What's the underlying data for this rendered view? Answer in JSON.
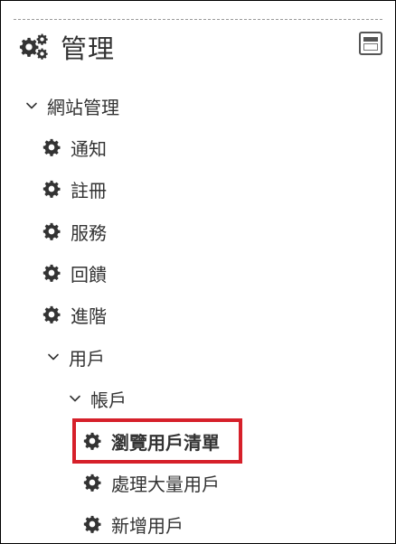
{
  "block": {
    "title": "管理",
    "icon": "gears-icon",
    "collapse_icon": "collapse-block-icon"
  },
  "tree": {
    "site_admin": {
      "label": "網站管理",
      "icon": "chevron-down-icon"
    },
    "notifications": {
      "label": "通知",
      "icon": "gear-icon"
    },
    "registration": {
      "label": "註冊",
      "icon": "gear-icon"
    },
    "services": {
      "label": "服務",
      "icon": "gear-icon"
    },
    "feedback": {
      "label": "回饋",
      "icon": "gear-icon"
    },
    "advanced": {
      "label": "進階",
      "icon": "gear-icon"
    },
    "users": {
      "label": "用戶",
      "icon": "chevron-down-icon"
    },
    "accounts": {
      "label": "帳戶",
      "icon": "chevron-down-icon"
    },
    "browse_users": {
      "label": "瀏覽用戶清單",
      "icon": "gear-icon",
      "highlighted": true
    },
    "bulk_users": {
      "label": "處理大量用戶",
      "icon": "gear-icon"
    },
    "add_user": {
      "label": "新增用戶",
      "icon": "gear-icon"
    }
  },
  "colors": {
    "text": "#333333",
    "icon": "#333333",
    "highlight_border": "#d6202a"
  }
}
